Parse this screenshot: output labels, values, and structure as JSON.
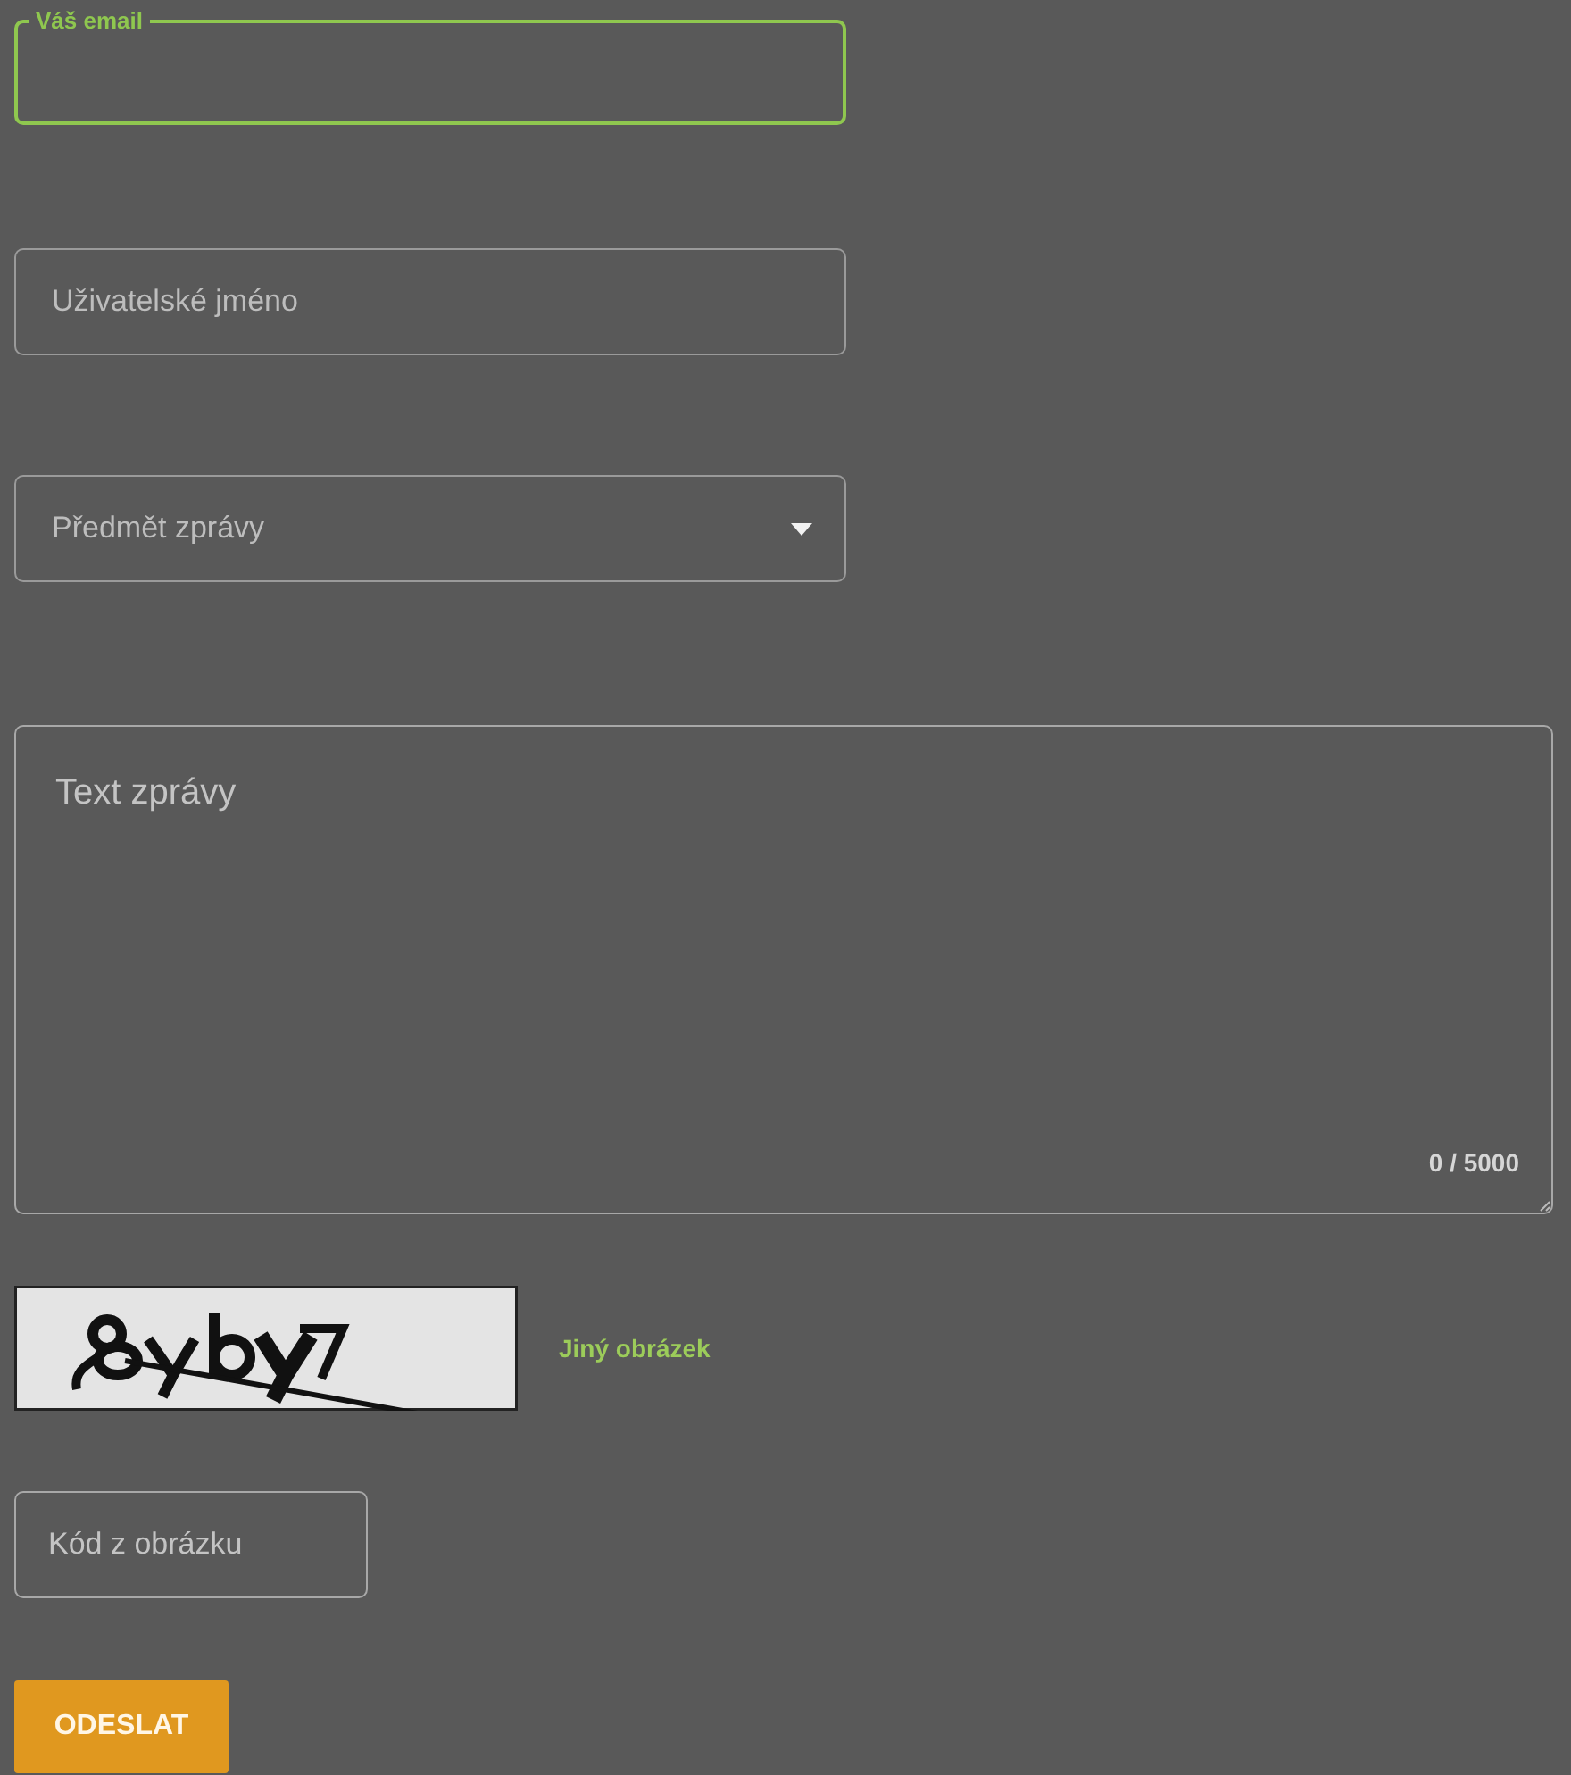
{
  "fields": [
    {
      "kind": "text",
      "label": "Váš email",
      "focused": true
    },
    {
      "kind": "text",
      "placeholder": "Uživatelské jméno",
      "focused": false
    },
    {
      "kind": "select",
      "placeholder": "Předmět zprávy",
      "focused": false
    }
  ],
  "message": {
    "placeholder": "Text zprávy",
    "counter": "0 / 5000"
  },
  "captcha": {
    "refresh_link": "Jiný obrázek"
  },
  "code_field": {
    "placeholder": "Kód z obrázku"
  },
  "submit_button": "ODESLAT"
}
